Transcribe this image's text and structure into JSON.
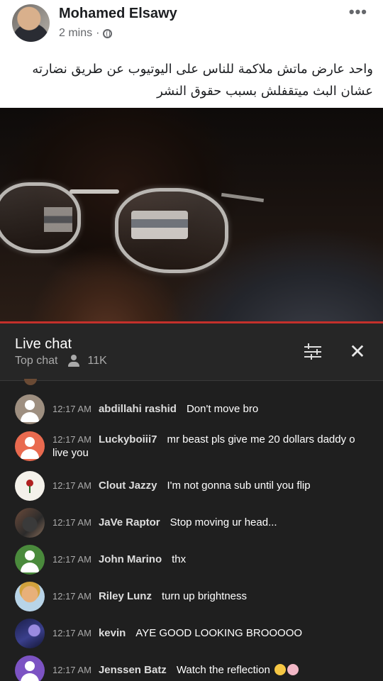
{
  "post": {
    "author": "Mohamed Elsawy",
    "time": "2 mins",
    "separator": "·",
    "more": "•••",
    "text_line1": "واحد عارض ماتش ملاكمة للناس على اليوتيوب عن طريق نضارته",
    "text_line2": "عشان البث ميتقفلش بسبب حقوق النشر"
  },
  "chat": {
    "title": "Live chat",
    "mode": "Top chat",
    "viewers": "11K",
    "close": "✕",
    "messages": [
      {
        "time": "12:17 AM",
        "name": "abdillahi rashid",
        "text": "Don't move bro"
      },
      {
        "time": "12:17 AM",
        "name": "Luckyboiii7",
        "text": "mr beast pls give me 20 dollars daddy o",
        "text2": "live you"
      },
      {
        "time": "12:17 AM",
        "name": "Clout Jazzy",
        "text": "I'm not gonna sub until you flip"
      },
      {
        "time": "12:17 AM",
        "name": "JaVe Raptor",
        "text": "Stop moving ur head..."
      },
      {
        "time": "12:17 AM",
        "name": "John Marino",
        "text": "thx"
      },
      {
        "time": "12:17 AM",
        "name": "Riley Lunz",
        "text": "turn up brightness"
      },
      {
        "time": "12:17 AM",
        "name": "kevin",
        "text": "AYE GOOD LOOKING BROOOOO"
      },
      {
        "time": "12:17 AM",
        "name": "Jenssen Batz",
        "text": "Watch the reflection"
      }
    ]
  },
  "colors": {
    "accent_red": "#c4302b",
    "chat_bg": "#1f1f1f",
    "fb_text": "#1c1e21"
  }
}
